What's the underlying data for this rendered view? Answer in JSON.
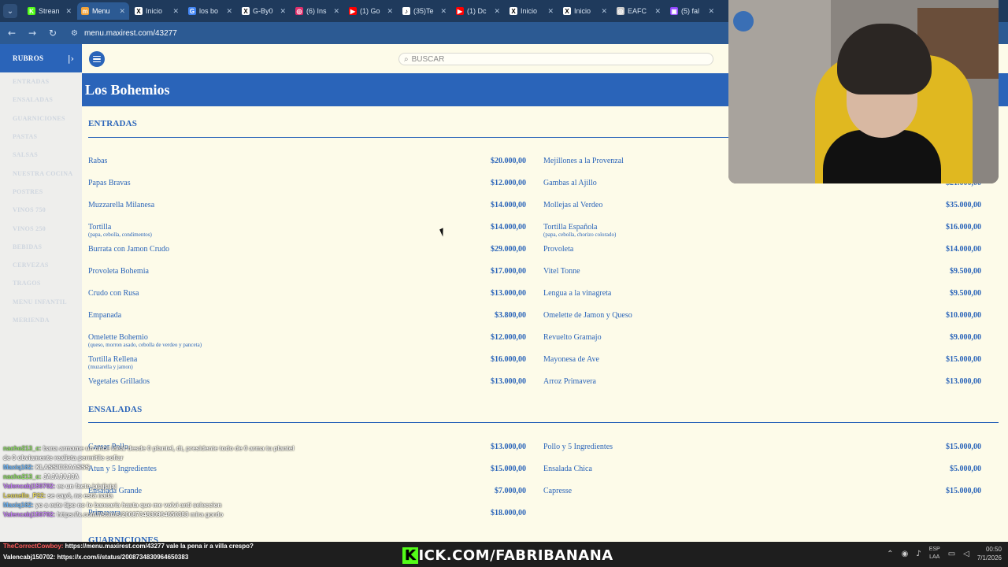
{
  "browser": {
    "tabs": [
      {
        "label": "Strean",
        "fav_color": "#53fc18",
        "fav_text": "K"
      },
      {
        "label": "Menu",
        "fav_color": "#f2a33a",
        "fav_text": "m",
        "active": true
      },
      {
        "label": "Inicio",
        "fav_color": "#ffffff",
        "fav_text": "X"
      },
      {
        "label": "los bo",
        "fav_color": "#4285f4",
        "fav_text": "G"
      },
      {
        "label": "G-By0",
        "fav_color": "#ffffff",
        "fav_text": "X"
      },
      {
        "label": "(6) Ins",
        "fav_color": "#e1306c",
        "fav_text": "◎"
      },
      {
        "label": "(1) Go",
        "fav_color": "#ff0000",
        "fav_text": "▶"
      },
      {
        "label": "(35)Te",
        "fav_color": "#ffffff",
        "fav_text": "♪"
      },
      {
        "label": "(1) Dc",
        "fav_color": "#ff0000",
        "fav_text": "▶"
      },
      {
        "label": "Inicio",
        "fav_color": "#ffffff",
        "fav_text": "X"
      },
      {
        "label": "Inicio",
        "fav_color": "#ffffff",
        "fav_text": "X"
      },
      {
        "label": "EAFC",
        "fav_color": "#cccccc",
        "fav_text": "◎"
      },
      {
        "label": "(5) fal",
        "fav_color": "#9146ff",
        "fav_text": "▣"
      }
    ],
    "url": "menu.maxirest.com/43277"
  },
  "sidebar": {
    "title": "RUBROS",
    "items": [
      "ENTRADAS",
      "ENSALADAS",
      "GUARNICIONES",
      "PASTAS",
      "SALSAS",
      "NUESTRA COCINA",
      "POSTRES",
      "VINOS 750",
      "VINOS 250",
      "BEBIDAS",
      "CERVEZAS",
      "TRAGOS",
      "MENU INFANTIL",
      "MERIENDA"
    ]
  },
  "header": {
    "search_placeholder": "BUSCAR",
    "restaurant_name": "Los Bohemios"
  },
  "sections": [
    {
      "title": "ENTRADAS",
      "left": [
        {
          "name": "Rabas",
          "price": "$20.000,00"
        },
        {
          "name": "Papas Bravas",
          "price": "$12.000,00"
        },
        {
          "name": "Muzzarella Milanesa",
          "price": "$14.000,00"
        },
        {
          "name": "Tortilla",
          "desc": "(papa, cebolla, condimentos)",
          "price": "$14.000,00"
        },
        {
          "name": "Burrata con Jamon Crudo",
          "price": "$29.000,00"
        },
        {
          "name": "Provoleta Bohemia",
          "price": "$17.000,00"
        },
        {
          "name": "Crudo con Rusa",
          "price": "$13.000,00"
        },
        {
          "name": "Empanada",
          "price": "$3.800,00"
        },
        {
          "name": "Omelette Bohemio",
          "desc": "(queso, morron asado, cebolla de verdeo y panceta)",
          "price": "$12.000,00"
        },
        {
          "name": "Tortilla Rellena",
          "desc": "(muzarella y jamon)",
          "price": "$16.000,00"
        },
        {
          "name": "Vegetales Grillados",
          "price": "$13.000,00"
        }
      ],
      "right": [
        {
          "name": "Mejillones a la Provenzal",
          "price": ""
        },
        {
          "name": "Gambas al Ajillo",
          "price": "$21.000,00"
        },
        {
          "name": "Mollejas al Verdeo",
          "price": "$35.000,00"
        },
        {
          "name": "Tortilla Española",
          "desc": "(papa, cebolla, chorizo colorado)",
          "price": "$16.000,00"
        },
        {
          "name": "Provoleta",
          "price": "$14.000,00"
        },
        {
          "name": "Vitel Tonne",
          "price": "$9.500,00"
        },
        {
          "name": "Lengua a la vinagreta",
          "price": "$9.500,00"
        },
        {
          "name": "Omelette de Jamon y Queso",
          "price": "$10.000,00"
        },
        {
          "name": "Revuelto Gramajo",
          "price": "$9.000,00"
        },
        {
          "name": "Mayonesa de Ave",
          "price": "$15.000,00"
        },
        {
          "name": "Arroz Primavera",
          "price": "$13.000,00"
        }
      ]
    },
    {
      "title": "ENSALADAS",
      "left": [
        {
          "name": "Caesar Pollo",
          "price": "$13.000,00"
        },
        {
          "name": "Atun y 5 Ingredientes",
          "price": "$15.000,00"
        },
        {
          "name": "Ensalada Grande",
          "price": "$7.000,00"
        },
        {
          "name": "Primavera",
          "price": "$18.000,00"
        }
      ],
      "right": [
        {
          "name": "Pollo y 5 Ingredientes",
          "price": "$15.000,00"
        },
        {
          "name": "Ensalada Chica",
          "price": "$5.000,00"
        },
        {
          "name": "Capresse",
          "price": "$15.000,00"
        }
      ]
    }
  ],
  "next_section_title": "GUARNICIONES",
  "chat": [
    {
      "user": "nacho213_c:",
      "text": " bana armame un once ideal desde 0 plantel, dt, presidente todo de 0 arma tu plantel de 0 obviamente realista permitile sofiar",
      "cls": ""
    },
    {
      "user": "Maxiq162:",
      "text": " KLASSICOAASSS",
      "cls": "u2"
    },
    {
      "user": "nacho213_c:",
      "text": " JAJAJAJJA",
      "cls": ""
    },
    {
      "user": "Valencabj150702:",
      "text": " es un facto jajajjajaj",
      "cls": "u4"
    },
    {
      "user": "Leonello_P22:",
      "text": " se cayó, no está nada",
      "cls": "u3"
    },
    {
      "user": "Maxiq162:",
      "text": " yo a este tipo no lo banearía hasta que me volvi anti seleccion",
      "cls": "u2"
    },
    {
      "user": "Valencabj150702:",
      "text": " https://x.com/i/status/2008734830964650383 mira gordo",
      "cls": "u4"
    }
  ],
  "notifications": [
    {
      "user": "TheCorrectCowboy:",
      "text": " https://menu.maxirest.com/43277 vale la pena ir a villa crespo?"
    },
    {
      "user": "Valencabj150702:",
      "text": " https://x.com/i/status/2008734830964650383"
    }
  ],
  "stream_banner": {
    "prefix": "K",
    "text": "ICK.COM/FABRIBANANA"
  },
  "tray": {
    "lang": "ESP",
    "layout": "LAA",
    "time": "00:50",
    "date": "7/1/2026"
  }
}
